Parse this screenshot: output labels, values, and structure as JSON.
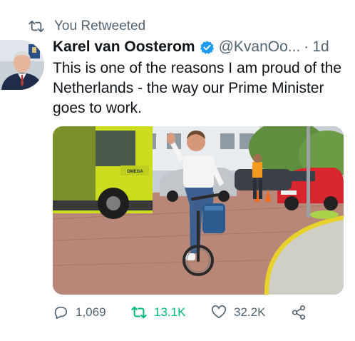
{
  "retweet_banner": {
    "text": "You Retweeted"
  },
  "tweet": {
    "author_name": "Karel van Oosterom",
    "handle": "@KvanOo...",
    "separator": "·",
    "time": "1d",
    "text": "This is one of the reasons I am proud of the Netherlands - the way our Prime Minister goes to work.",
    "media_truck_label": "OMEGA"
  },
  "actions": {
    "replies": "1,069",
    "retweets": "13.1K",
    "likes": "32.2K"
  },
  "colors": {
    "retweet_active": "#00ba7c",
    "verified": "#1d9bf0",
    "secondary_text": "#536471"
  },
  "icons": [
    "retweet-icon",
    "verified-badge-icon",
    "reply-icon",
    "like-icon",
    "share-icon"
  ]
}
